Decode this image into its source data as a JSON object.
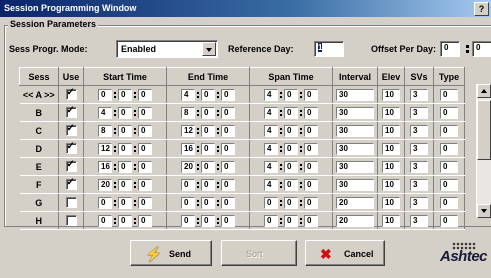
{
  "window": {
    "title": "Session Programming Window",
    "help_label": "?"
  },
  "params": {
    "group_title": "Session Parameters",
    "mode_label": "Sess Progr. Mode:",
    "mode_value": "Enabled",
    "ref_day_label": "Reference Day:",
    "ref_day_value": "1",
    "offset_label": "Offset Per Day:",
    "offset_min": "0",
    "offset_sec": "0"
  },
  "table": {
    "headers": [
      "Sess",
      "Use",
      "Start Time",
      "End Time",
      "Span Time",
      "Interval",
      "Elev",
      "SVs",
      "Type"
    ],
    "rows": [
      {
        "sess": "<< A >>",
        "use": true,
        "start": [
          "0",
          "0",
          "0"
        ],
        "end": [
          "4",
          "0",
          "0"
        ],
        "span": [
          "4",
          "0",
          "0"
        ],
        "interval": "30",
        "elev": "10",
        "svs": "3",
        "type": "0"
      },
      {
        "sess": "B",
        "use": true,
        "start": [
          "4",
          "0",
          "0"
        ],
        "end": [
          "8",
          "0",
          "0"
        ],
        "span": [
          "4",
          "0",
          "0"
        ],
        "interval": "30",
        "elev": "10",
        "svs": "3",
        "type": "0"
      },
      {
        "sess": "C",
        "use": true,
        "start": [
          "8",
          "0",
          "0"
        ],
        "end": [
          "12",
          "0",
          "0"
        ],
        "span": [
          "4",
          "0",
          "0"
        ],
        "interval": "30",
        "elev": "10",
        "svs": "3",
        "type": "0"
      },
      {
        "sess": "D",
        "use": true,
        "start": [
          "12",
          "0",
          "0"
        ],
        "end": [
          "16",
          "0",
          "0"
        ],
        "span": [
          "4",
          "0",
          "0"
        ],
        "interval": "30",
        "elev": "10",
        "svs": "3",
        "type": "0"
      },
      {
        "sess": "E",
        "use": true,
        "start": [
          "16",
          "0",
          "0"
        ],
        "end": [
          "20",
          "0",
          "0"
        ],
        "span": [
          "4",
          "0",
          "0"
        ],
        "interval": "30",
        "elev": "10",
        "svs": "3",
        "type": "0"
      },
      {
        "sess": "F",
        "use": true,
        "start": [
          "20",
          "0",
          "0"
        ],
        "end": [
          "0",
          "0",
          "0"
        ],
        "span": [
          "4",
          "0",
          "0"
        ],
        "interval": "30",
        "elev": "10",
        "svs": "3",
        "type": "0"
      },
      {
        "sess": "G",
        "use": false,
        "start": [
          "0",
          "0",
          "0"
        ],
        "end": [
          "0",
          "0",
          "0"
        ],
        "span": [
          "0",
          "0",
          "0"
        ],
        "interval": "20",
        "elev": "10",
        "svs": "3",
        "type": "0"
      },
      {
        "sess": "H",
        "use": false,
        "start": [
          "0",
          "0",
          "0"
        ],
        "end": [
          "0",
          "0",
          "0"
        ],
        "span": [
          "0",
          "0",
          "0"
        ],
        "interval": "20",
        "elev": "10",
        "svs": "3",
        "type": "0"
      }
    ]
  },
  "buttons": {
    "send": "Send",
    "sort": "Sort",
    "cancel": "Cancel"
  },
  "icons": {
    "send": "lightning-icon",
    "cancel": "red-x-icon"
  },
  "logo": "Ashtec"
}
